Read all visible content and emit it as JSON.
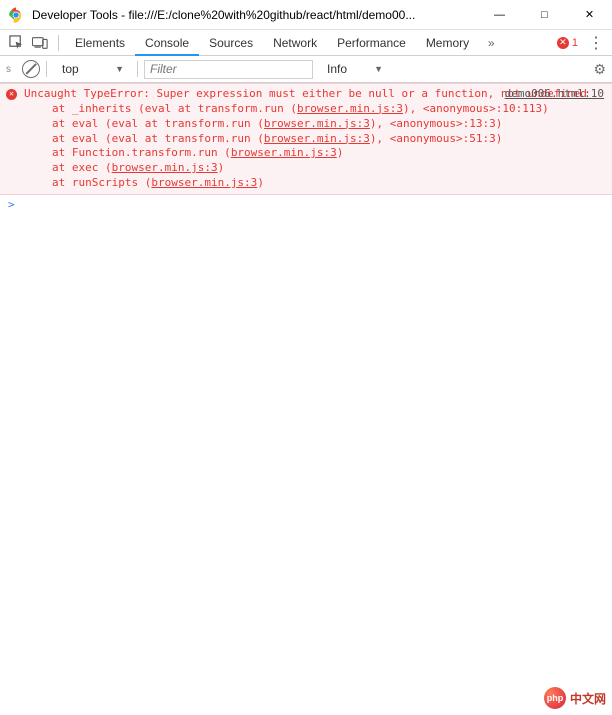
{
  "window": {
    "title": "Developer Tools - file:///E:/clone%20with%20github/react/html/demo00..."
  },
  "tabs": {
    "items": [
      "Elements",
      "Console",
      "Sources",
      "Network",
      "Performance",
      "Memory"
    ],
    "active_index": 1,
    "error_count": "1"
  },
  "filter_row": {
    "left_gutter": "s",
    "frame": "top",
    "filter_placeholder": "Filter",
    "level": "Info"
  },
  "error": {
    "source_link": "demo006.html:10",
    "message": "Uncaught TypeError: Super expression must either be null or a function, not undefined",
    "stack": [
      {
        "prefix": "at _inherits (eval at transform.run (",
        "link": "browser.min.js:3",
        "suffix": "), <anonymous>:10:113)"
      },
      {
        "prefix": "at eval (eval at transform.run (",
        "link": "browser.min.js:3",
        "suffix": "), <anonymous>:13:3)"
      },
      {
        "prefix": "at eval (eval at transform.run (",
        "link": "browser.min.js:3",
        "suffix": "), <anonymous>:51:3)"
      },
      {
        "prefix": "at Function.transform.run (",
        "link": "browser.min.js:3",
        "suffix": ")"
      },
      {
        "prefix": "at exec (",
        "link": "browser.min.js:3",
        "suffix": ")"
      },
      {
        "prefix": "at runScripts (",
        "link": "browser.min.js:3",
        "suffix": ")"
      }
    ]
  },
  "prompt": ">",
  "watermark": {
    "badge": "php",
    "text": "中文网"
  }
}
